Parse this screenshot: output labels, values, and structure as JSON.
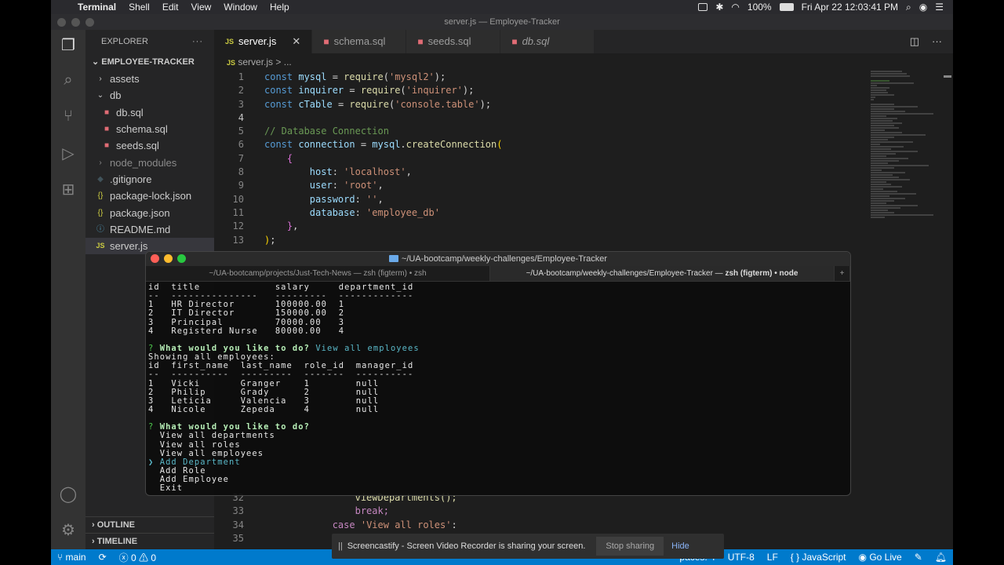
{
  "menubar": {
    "app": "Terminal",
    "items": [
      "Shell",
      "Edit",
      "View",
      "Window",
      "Help"
    ],
    "battery": "100%",
    "datetime": "Fri Apr 22  12:03:41 PM"
  },
  "window_title": "server.js — Employee-Tracker",
  "sidebar": {
    "header": "EXPLORER",
    "project": "EMPLOYEE-TRACKER",
    "items": [
      {
        "label": "assets",
        "kind": "folder"
      },
      {
        "label": "db",
        "kind": "folder-open"
      },
      {
        "label": "db.sql",
        "kind": "sql"
      },
      {
        "label": "schema.sql",
        "kind": "sql"
      },
      {
        "label": "seeds.sql",
        "kind": "sql"
      },
      {
        "label": "node_modules",
        "kind": "folder"
      },
      {
        "label": ".gitignore",
        "kind": "git"
      },
      {
        "label": "package-lock.json",
        "kind": "json"
      },
      {
        "label": "package.json",
        "kind": "json"
      },
      {
        "label": "README.md",
        "kind": "info"
      },
      {
        "label": "server.js",
        "kind": "js"
      }
    ],
    "outline": "OUTLINE",
    "timeline": "TIMELINE"
  },
  "tabs": [
    {
      "label": "server.js",
      "icon": "JS"
    },
    {
      "label": "schema.sql",
      "icon": "db"
    },
    {
      "label": "seeds.sql",
      "icon": "db"
    },
    {
      "label": "db.sql",
      "icon": "db"
    }
  ],
  "breadcrumb": {
    "file": "server.js",
    "rest": "> ..."
  },
  "code_lines": [
    {
      "n": "1"
    },
    {
      "n": "2"
    },
    {
      "n": "3"
    },
    {
      "n": "4"
    },
    {
      "n": "5"
    },
    {
      "n": "6"
    },
    {
      "n": "7"
    },
    {
      "n": "8"
    },
    {
      "n": "9"
    },
    {
      "n": "10"
    },
    {
      "n": "11"
    },
    {
      "n": "12"
    },
    {
      "n": "13"
    }
  ],
  "code_tail": {
    "n32": "32",
    "t32": "viewDepartments();",
    "n33": "33",
    "t33": "break;",
    "n34": "34",
    "t34_kw": "case",
    "t34_str": "'View all roles'",
    "t34_end": ":",
    "n35": "35"
  },
  "terminal": {
    "title": "~/UA-bootcamp/weekly-challenges/Employee-Tracker",
    "tab1": "~/UA-bootcamp/projects/Just-Tech-News — zsh (figterm) • zsh",
    "tab2_a": "~/UA-bootcamp/weekly-challenges/Employee-Tracker — ",
    "tab2_b": "zsh (figterm) • node",
    "lines": [
      "id  title             salary     department_id",
      "--  ---------------   ---------  -------------",
      "1   HR Director       100000.00  1",
      "2   IT Director       150000.00  2",
      "3   Principal         70000.00   3",
      "4   Registerd Nurse   80000.00   4"
    ],
    "q1_mark": "?",
    "q1_text": "What would you like to do?",
    "q1_answer": "View all employees",
    "showing": "Showing all employees:",
    "emp_lines": [
      "id  first_name  last_name  role_id  manager_id",
      "--  ----------  ---------  -------  ----------",
      "1   Vicki       Granger    1        null",
      "2   Philip      Grady      2        null",
      "3   Leticia     Valencia   3        null",
      "4   Nicole      Zepeda     4        null"
    ],
    "q2_mark": "?",
    "q2_text": "What would you like to do?",
    "options": [
      "View all departments",
      "View all roles",
      "View all employees",
      "Add Department",
      "Add Role",
      "Add Employee",
      "Exit"
    ],
    "selected_index": 3
  },
  "statusbar": {
    "branch": "main",
    "errors": "0",
    "warnings": "0",
    "spaces": "paces: 4",
    "encoding": "UTF-8",
    "eol": "LF",
    "braces": "{ }",
    "language": "JavaScript",
    "golive": "Go Live"
  },
  "screencast": {
    "message": "Screencastify - Screen Video Recorder is sharing your screen.",
    "stop": "Stop sharing",
    "hide": "Hide"
  }
}
